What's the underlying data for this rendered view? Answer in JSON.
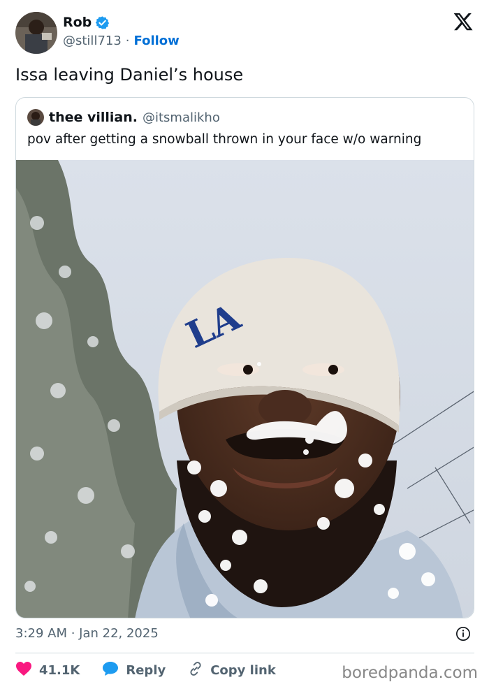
{
  "author": {
    "name": "Rob",
    "handle": "@still713",
    "separator": "·",
    "follow_label": "Follow"
  },
  "tweet": {
    "text": "Issa leaving Daniel’s house",
    "timestamp": "3:29 AM · Jan 22, 2025"
  },
  "quoted": {
    "name": "thee villian.",
    "handle": "@itsmalikho",
    "text": "pov after getting a snowball thrown in your face w/o warning"
  },
  "actions": {
    "likes": "41.1K",
    "reply_label": "Reply",
    "copy_label": "Copy link"
  },
  "watermark": "boredpanda.com",
  "colors": {
    "link_blue": "#006fd6",
    "like_red": "#f91880",
    "verified_blue": "#1d9bf0",
    "muted": "#536471"
  },
  "icons": [
    "verified-badge-icon",
    "x-logo-icon",
    "info-icon",
    "heart-icon",
    "reply-icon",
    "link-icon"
  ]
}
